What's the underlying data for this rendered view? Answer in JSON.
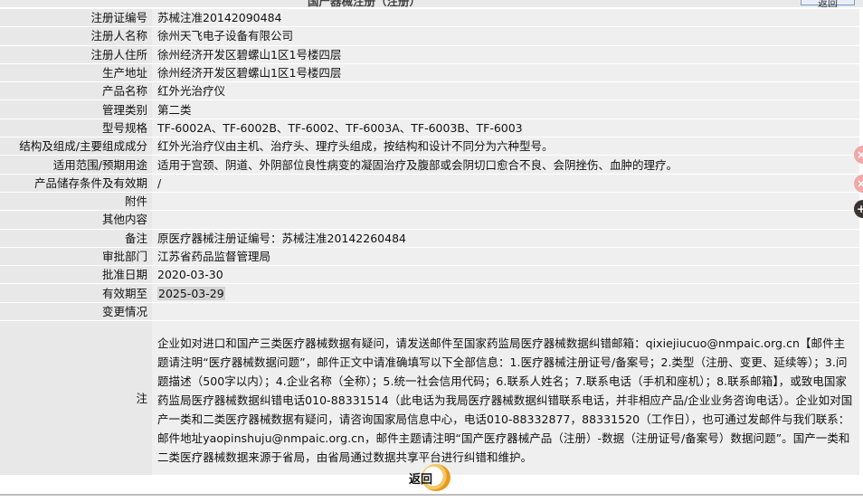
{
  "page": {
    "partial_title": "国产器械注册（注册）",
    "partial_button": "返回"
  },
  "fields": [
    {
      "label": "注册证编号",
      "value": "苏械注准20142090484"
    },
    {
      "label": "注册人名称",
      "value": "徐州天飞电子设备有限公司"
    },
    {
      "label": "注册人住所",
      "value": "徐州经济开发区碧螺山1区1号楼四层"
    },
    {
      "label": "生产地址",
      "value": "徐州经济开发区碧螺山1区1号楼四层"
    },
    {
      "label": "产品名称",
      "value": "红外光治疗仪"
    },
    {
      "label": "管理类别",
      "value": "第二类"
    },
    {
      "label": "型号规格",
      "value": "TF-6002A、TF-6002B、TF-6002、TF-6003A、TF-6003B、TF-6003"
    },
    {
      "label": "结构及组成/主要组成成分",
      "value": "红外光治疗仪由主机、治疗头、理疗头组成，按结构和设计不同分为六种型号。"
    },
    {
      "label": "适用范围/预期用途",
      "value": "适用于宫颈、阴道、外阴部位良性病变的凝固治疗及腹部或会阴切口愈合不良、会阴挫伤、血肿的理疗。"
    },
    {
      "label": "产品储存条件及有效期",
      "value": "/"
    },
    {
      "label": "附件",
      "value": ""
    },
    {
      "label": "其他内容",
      "value": ""
    },
    {
      "label": "备注",
      "value": "原医疗器械注册证编号：苏械注准20142260484"
    },
    {
      "label": "审批部门",
      "value": "江苏省药品监督管理局"
    },
    {
      "label": "批准日期",
      "value": "2020-03-30"
    },
    {
      "label": "有效期至",
      "value": "2025-03-29"
    },
    {
      "label": "变更情况",
      "value": ""
    }
  ],
  "note": {
    "label": "注",
    "text": "企业如对进口和国产三类医疗器械数据有疑问，请发送邮件至国家药监局医疗器械数据纠错邮箱：qixiejiucuo@nmpaic.org.cn【邮件主题请注明“医疗器械数据问题”，邮件正文中请准确填写以下全部信息：1.医疗器械注册证号/备案号；2.类型（注册、变更、延续等）；3.问题描述（500字以内）；4.企业名称（全称）；5.统一社会信用代码；6.联系人姓名；7.联系电话（手机和座机）；8.联系邮箱】，或致电国家药监局医疗器械数据纠错电话010-88331514（此电话为我局医疗器械数据纠错联系电话，并非相应产品/企业业务咨询电话）。企业如对国产一类和二类医疗器械数据有疑问，请咨询国家局信息中心，电话010-88332877，88331520（工作日），也可通过发邮件与我们联系：邮件地址yaopinshuju@nmpaic.org.cn，邮件主题请注明“国产医疗器械产品（注册）-数据（注册证号/备案号）数据问题”。国产一类和二类医疗器械数据来源于省局，由省局通过数据共享平台进行纠错和维护。"
  },
  "back_button": "返回",
  "side_icons": [
    "close-icon",
    "close-icon",
    "plus-icon"
  ]
}
